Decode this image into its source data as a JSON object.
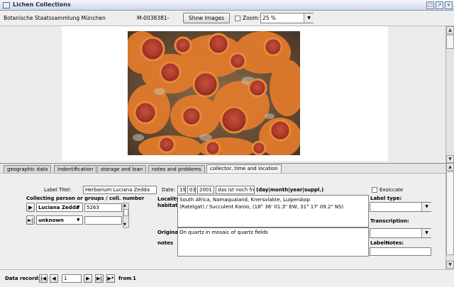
{
  "window": {
    "title": "Lichen Collections"
  },
  "header": {
    "institution": "Botanische Staatssammlung München",
    "record_id": "M-0038381-",
    "show_images_label": "Show Images",
    "zoom_label": "Zoom:",
    "zoom_value": "25 %"
  },
  "tabs": [
    {
      "label": "geographic data"
    },
    {
      "label": "indentification"
    },
    {
      "label": "storage and loan"
    },
    {
      "label": "notes and problems"
    },
    {
      "label": "collector, time and location"
    }
  ],
  "form": {
    "label_title_caption": "Label Titel:",
    "label_title_value": "Herbarium Luciana Zedda",
    "date_caption": "Date:",
    "date_day": "19",
    "date_month": "03",
    "date_year": "2001",
    "date_suppl": "das ist noch frei",
    "date_hint": "(day|month|year|suppl.)",
    "exsiccate_label": "Exsiccate",
    "collecting_caption": "Collecting person or groups / coll. number",
    "collector1_name": "Luciana Zedda",
    "collector1_number": "5263",
    "collector2_name": "unknown",
    "collector2_number": "",
    "locality_caption": "Locality",
    "habitat_caption": "habitat:",
    "locality_line1": "South Africa, Namaqualand, Knersvlakte, Luiperskop",
    "locality_line2": "(Ratelgat) / Succulent Karoo,  (18° 36' 01.3\" EW, 31° 17' 09.2\" NS)",
    "original_caption": "Original",
    "notes_caption": "notes",
    "original_notes": "On quartz in mosaic of quartz fields",
    "label_type_caption": "Label type:",
    "transcription_caption": "Transcription:",
    "label_notes_caption": "LabelNotes:"
  },
  "footer": {
    "data_record_label": "Data record:",
    "current_record": "1",
    "from_label": "from",
    "total_records": "1"
  }
}
